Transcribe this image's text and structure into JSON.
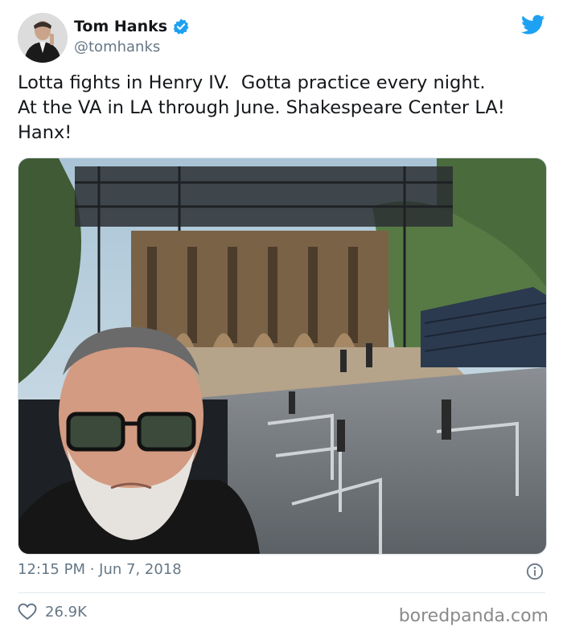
{
  "author": {
    "name": "Tom Hanks",
    "handle": "@tomhanks"
  },
  "tweet": {
    "text": "Lotta fights in Henry IV.  Gotta practice every night.\nAt the VA in LA through June. Shakespeare Center LA!\nHanx!",
    "timestamp": "12:15 PM · Jun 7, 2018"
  },
  "stats": {
    "likes": "26.9K"
  },
  "watermark": "boredpanda.com",
  "icons": {
    "verified": "verified-badge-icon",
    "brand": "twitter-bird-icon",
    "info": "info-icon",
    "like": "heart-icon"
  },
  "colors": {
    "brand_blue": "#1da1f2",
    "muted_text": "#657786",
    "divider": "#e1e8ed"
  }
}
